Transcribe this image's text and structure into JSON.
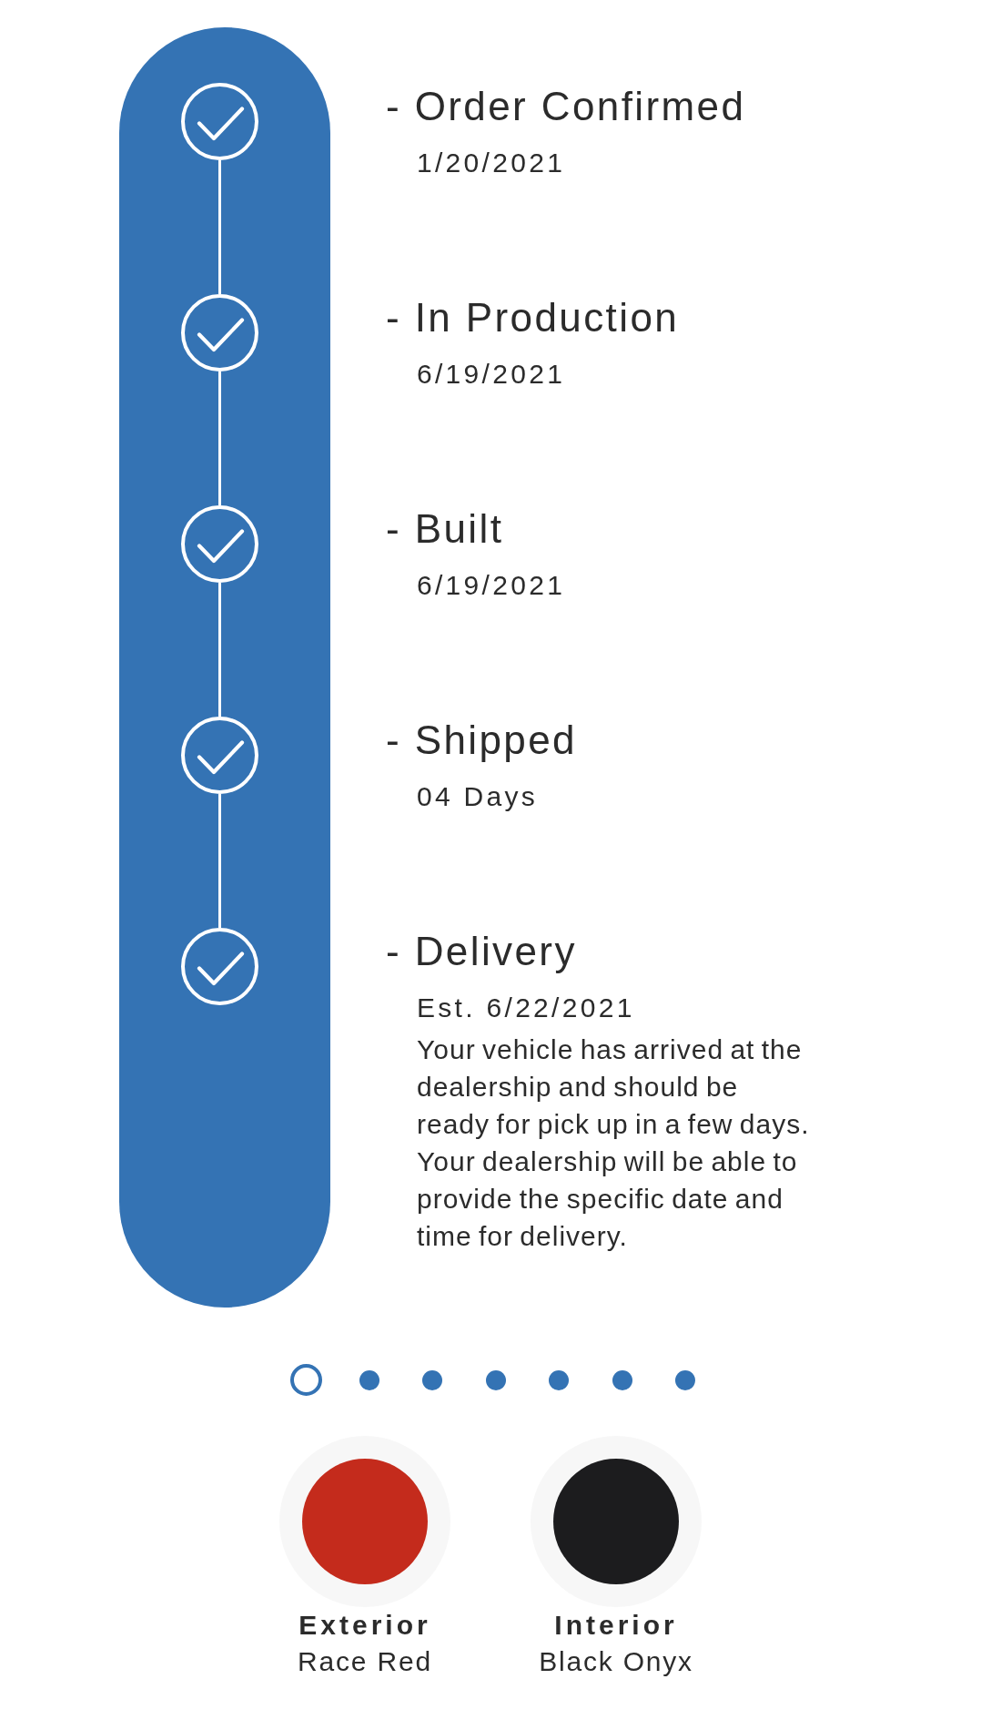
{
  "timeline": {
    "steps": [
      {
        "title": "- Order Confirmed",
        "date": "1/20/2021",
        "completed": true
      },
      {
        "title": "- In Production",
        "date": "6/19/2021",
        "completed": true
      },
      {
        "title": "- Built",
        "date": "6/19/2021",
        "completed": true
      },
      {
        "title": "- Shipped",
        "date": "04 Days",
        "completed": true
      },
      {
        "title": "- Delivery",
        "date": "Est. 6/22/2021",
        "description": "Your vehicle has arrived at the dealership and should be ready for pick up in a few days. Your dealership will be able to provide the specific date and time for delivery.",
        "completed": true
      }
    ]
  },
  "pagination": {
    "dots": [
      {
        "selected": true
      },
      {
        "selected": false
      },
      {
        "selected": false
      },
      {
        "selected": false
      },
      {
        "selected": false
      },
      {
        "selected": false
      },
      {
        "selected": false
      }
    ]
  },
  "colors": [
    {
      "label": "Exterior",
      "name": "Race Red",
      "color": "#c42b1c"
    },
    {
      "label": "Interior",
      "name": "Black Onyx",
      "color": "#1c1c1e"
    }
  ]
}
